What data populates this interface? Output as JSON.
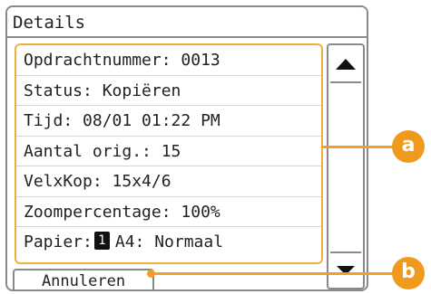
{
  "screen": {
    "title": "Details"
  },
  "details": {
    "rows": [
      {
        "text": "Opdrachtnummer: 0013"
      },
      {
        "text": "Status: Kopiëren"
      },
      {
        "text": "Tijd: 08/01 01:22 PM"
      },
      {
        "text": "Aantal orig.: 15"
      },
      {
        "text": "VelxKop: 15x4/6"
      },
      {
        "text": "Zoompercentage: 100%"
      }
    ],
    "paper": {
      "label": "Papier:",
      "source_number": "1",
      "value": "A4: Normaal"
    }
  },
  "scrollbar": {
    "up_icon": "triangle-up-icon",
    "down_icon": "triangle-down-icon"
  },
  "actions": {
    "cancel_label": "Annuleren"
  },
  "callouts": {
    "a": "a",
    "b": "b"
  },
  "colors": {
    "accent": "#f0a028",
    "border": "#8a8a8a"
  }
}
